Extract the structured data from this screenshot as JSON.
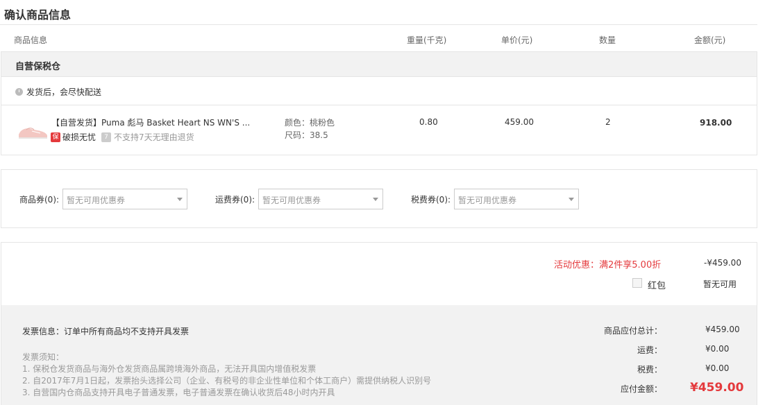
{
  "page": {
    "title": "确认商品信息"
  },
  "columns": {
    "product": "商品信息",
    "weight": "重量(千克)",
    "unit_price": "单价(元)",
    "qty": "数量",
    "amount": "金额(元)"
  },
  "warehouse": {
    "name": "自营保税仓",
    "ship_note": "发货后，会尽快配送"
  },
  "item": {
    "name": "【自营发货】Puma 彪马 Basket Heart NS WN'S ...",
    "tag1_icon": "保",
    "tag1_text": "破损无忧",
    "tag2_icon": "7",
    "tag2_text": "不支持7天无理由退货",
    "color": "颜色：桃粉色",
    "size": "尺码：38.5",
    "weight": "0.80",
    "unit_price": "459.00",
    "qty": "2",
    "amount": "918.00"
  },
  "coupons": {
    "goods_label": "商品券(0):",
    "ship_label": "运费券(0):",
    "tax_label": "税费券(0):",
    "none_text": "暂无可用优惠券"
  },
  "summary": {
    "promo_label": "活动优惠：满2件享5.00折",
    "promo_amount": "-¥459.00",
    "hongbao_label": "红包",
    "hongbao_value": "暂无可用",
    "invoice_info": "发票信息：订单中所有商品均不支持开具发票",
    "invoice_notes_title": "发票须知：",
    "invoice_note_1": "1. 保税仓发货商品与海外仓发货商品属跨境海外商品，无法开具国内增值税发票",
    "invoice_note_2": "2. 自2017年7月1日起，发票抬头选择公司（企业、有税号的非企业性单位和个体工商户）需提供纳税人识别号",
    "invoice_note_3": "3. 自营国内仓商品支持开具电子普通发票，电子普通发票在确认收货后48小时内开具",
    "goods_total_label": "商品应付总计：",
    "goods_total": "¥459.00",
    "shipping_label": "运费：",
    "shipping": "¥0.00",
    "tax_label": "税费：",
    "tax": "¥0.00",
    "payable_label": "应付金额：",
    "payable": "¥459.00"
  },
  "colors": {
    "accent_red": "#e4393c",
    "header_grey": "#f2f2f2",
    "border": "#e5e5e5"
  },
  "icons": {
    "clock": "clock-icon",
    "thumbnail": "shoe-thumbnail",
    "dropdown": "chevron-down-icon"
  }
}
